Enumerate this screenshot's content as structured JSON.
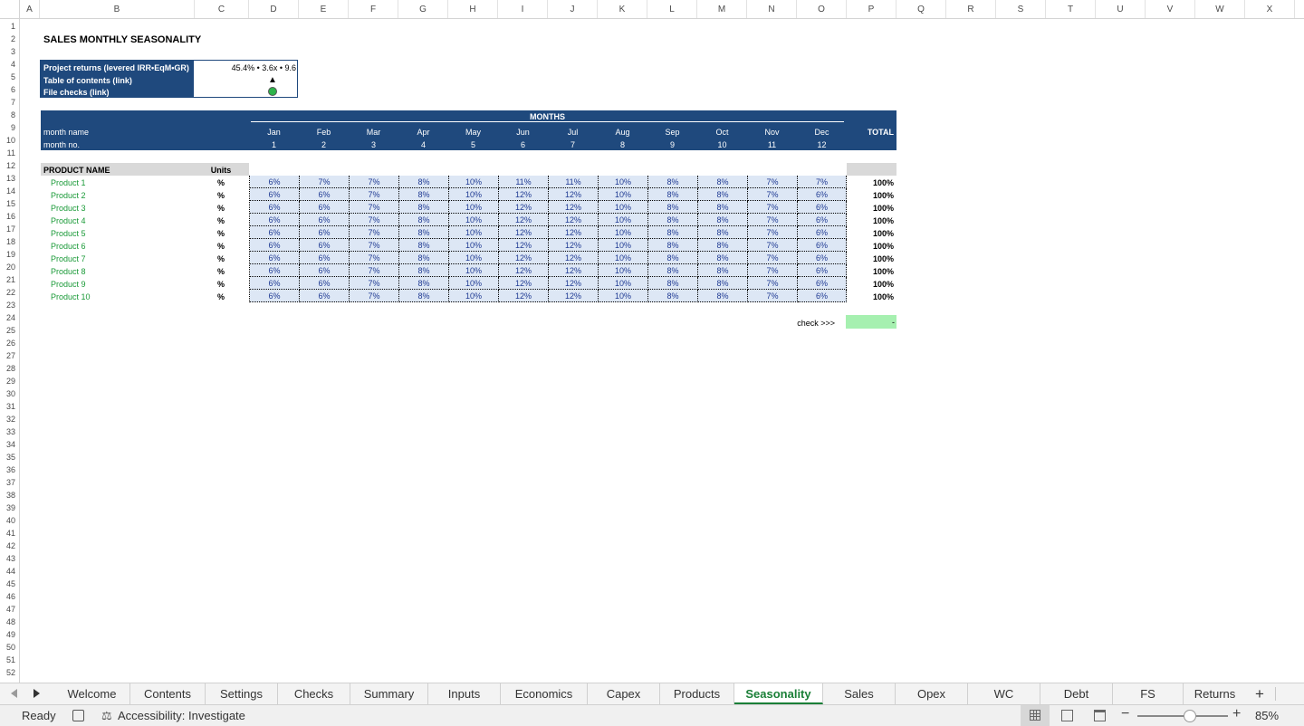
{
  "columns": [
    "A",
    "B",
    "C",
    "D",
    "E",
    "F",
    "G",
    "H",
    "I",
    "J",
    "K",
    "L",
    "M",
    "N",
    "O",
    "P",
    "Q",
    "R",
    "S",
    "T",
    "U",
    "V",
    "W",
    "X"
  ],
  "rows": [
    1,
    2,
    3,
    4,
    5,
    6,
    7,
    8,
    9,
    10,
    11,
    12,
    13,
    14,
    15,
    16,
    17,
    18,
    19,
    20,
    21,
    22,
    23,
    24,
    25,
    26,
    27,
    28,
    29,
    30,
    31,
    32,
    33,
    34,
    35,
    36,
    37,
    38,
    39,
    40,
    41,
    42,
    43,
    44,
    45,
    46,
    47,
    48,
    49,
    50,
    51,
    52
  ],
  "title": "SALES MONTHLY SEASONALITY",
  "info": {
    "returns_label": "Project returns (levered IRR•EqM•GR)",
    "returns_value": "45.4% • 3.6x • 9.6",
    "toc_label": "Table of contents (link)",
    "toc_symbol": "▲",
    "checks_label": "File checks (link)",
    "checks_status_color": "#2db34a"
  },
  "header": {
    "months_label": "MONTHS",
    "month_name_label": "month name",
    "month_no_label": "month no.",
    "total_label": "TOTAL",
    "months": [
      "Jan",
      "Feb",
      "Mar",
      "Apr",
      "May",
      "Jun",
      "Jul",
      "Aug",
      "Sep",
      "Oct",
      "Nov",
      "Dec"
    ],
    "month_nos": [
      "1",
      "2",
      "3",
      "4",
      "5",
      "6",
      "7",
      "8",
      "9",
      "10",
      "11",
      "12"
    ]
  },
  "table": {
    "product_header": "PRODUCT NAME",
    "units_header": "Units",
    "products": [
      {
        "name": "Product 1",
        "unit": "%",
        "values": [
          "6%",
          "7%",
          "7%",
          "8%",
          "10%",
          "11%",
          "11%",
          "10%",
          "8%",
          "8%",
          "7%",
          "7%"
        ],
        "total": "100%"
      },
      {
        "name": "Product 2",
        "unit": "%",
        "values": [
          "6%",
          "6%",
          "7%",
          "8%",
          "10%",
          "12%",
          "12%",
          "10%",
          "8%",
          "8%",
          "7%",
          "6%"
        ],
        "total": "100%"
      },
      {
        "name": "Product 3",
        "unit": "%",
        "values": [
          "6%",
          "6%",
          "7%",
          "8%",
          "10%",
          "12%",
          "12%",
          "10%",
          "8%",
          "8%",
          "7%",
          "6%"
        ],
        "total": "100%"
      },
      {
        "name": "Product 4",
        "unit": "%",
        "values": [
          "6%",
          "6%",
          "7%",
          "8%",
          "10%",
          "12%",
          "12%",
          "10%",
          "8%",
          "8%",
          "7%",
          "6%"
        ],
        "total": "100%"
      },
      {
        "name": "Product 5",
        "unit": "%",
        "values": [
          "6%",
          "6%",
          "7%",
          "8%",
          "10%",
          "12%",
          "12%",
          "10%",
          "8%",
          "8%",
          "7%",
          "6%"
        ],
        "total": "100%"
      },
      {
        "name": "Product 6",
        "unit": "%",
        "values": [
          "6%",
          "6%",
          "7%",
          "8%",
          "10%",
          "12%",
          "12%",
          "10%",
          "8%",
          "8%",
          "7%",
          "6%"
        ],
        "total": "100%"
      },
      {
        "name": "Product 7",
        "unit": "%",
        "values": [
          "6%",
          "6%",
          "7%",
          "8%",
          "10%",
          "12%",
          "12%",
          "10%",
          "8%",
          "8%",
          "7%",
          "6%"
        ],
        "total": "100%"
      },
      {
        "name": "Product 8",
        "unit": "%",
        "values": [
          "6%",
          "6%",
          "7%",
          "8%",
          "10%",
          "12%",
          "12%",
          "10%",
          "8%",
          "8%",
          "7%",
          "6%"
        ],
        "total": "100%"
      },
      {
        "name": "Product 9",
        "unit": "%",
        "values": [
          "6%",
          "6%",
          "7%",
          "8%",
          "10%",
          "12%",
          "12%",
          "10%",
          "8%",
          "8%",
          "7%",
          "6%"
        ],
        "total": "100%"
      },
      {
        "name": "Product 10",
        "unit": "%",
        "values": [
          "6%",
          "6%",
          "7%",
          "8%",
          "10%",
          "12%",
          "12%",
          "10%",
          "8%",
          "8%",
          "7%",
          "6%"
        ],
        "total": "100%"
      }
    ]
  },
  "check": {
    "label": "check >>>",
    "value": "-",
    "color": "#a6f0b0"
  },
  "tabs": [
    "Welcome",
    "Contents",
    "Settings",
    "Checks",
    "Summary",
    "Inputs",
    "Economics",
    "Capex",
    "Products",
    "Seasonality",
    "Sales",
    "Opex",
    "WC",
    "Debt",
    "FS",
    "Returns"
  ],
  "active_tab": "Seasonality",
  "add_sheet_symbol": "+",
  "status": {
    "ready": "Ready",
    "accessibility": "Accessibility: Investigate",
    "zoom": "85%",
    "zoom_level_fraction": 0.58
  }
}
